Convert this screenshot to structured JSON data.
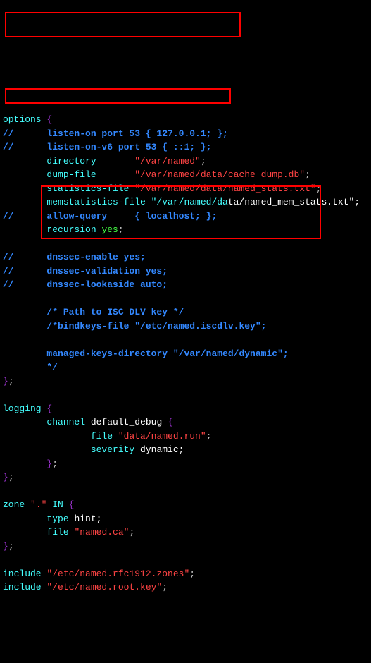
{
  "l0": {
    "a": "options",
    "b": "{"
  },
  "l1": {
    "a": "//      listen-on port 53 { 127.0.0.1; };"
  },
  "l2": {
    "a": "//      listen-on-v6 port 53 { ::1; };"
  },
  "l3": {
    "a": "        directory",
    "b": "\"/var/named\"",
    "c": ";"
  },
  "l4": {
    "a": "        dump-file",
    "b": "\"/var/named/data/cache_dump.db\"",
    "c": ";"
  },
  "l5": {
    "a": "        statistics-file",
    "b": "\"/var/named/data/named_stats.txt\"",
    "c": ";"
  },
  "l6": {
    "a": "        memstatistics-file \"/var/named/da",
    "b": "ta/named_mem_stats.txt\";"
  },
  "l7": {
    "a": "//      allow-query     { localhost; };"
  },
  "l8": {
    "a": "        recursion",
    "b": "yes",
    "c": ";"
  },
  "l9": {
    "a": "//      dnssec-enable yes;"
  },
  "l10": {
    "a": "//      dnssec-validation yes;"
  },
  "l11": {
    "a": "//      dnssec-lookaside auto;"
  },
  "l12": {
    "a": "        /* Path to ISC DLV key */"
  },
  "l13": {
    "a": "        /*bindkeys-file \"/etc/named.iscdlv.key\";"
  },
  "l14": {
    "a": "        managed-keys-directory \"/var/named/dynamic\";"
  },
  "l14b": {
    "a": "        */"
  },
  "l15": {
    "a": "}",
    "b": ";"
  },
  "l16": {
    "a": "logging",
    "b": "{"
  },
  "l17": {
    "a": "        channel",
    "b": "default_debug",
    "c": "{"
  },
  "l18": {
    "a": "                file",
    "b": "\"data/named.run\"",
    "c": ";"
  },
  "l19": {
    "a": "                severity",
    "b": "dynamic;"
  },
  "l20": {
    "a": "        }",
    "b": ";"
  },
  "l21": {
    "a": "}",
    "b": ";"
  },
  "l22": {
    "a": "zone",
    "b": "\".\"",
    "c": "IN",
    "d": "{"
  },
  "l23": {
    "a": "        type",
    "b": "hint;"
  },
  "l24": {
    "a": "        file",
    "b": "\"named.ca\"",
    "c": ";"
  },
  "l25": {
    "a": "}",
    "b": ";"
  },
  "l26": {
    "a": "include",
    "b": "\"/etc/named.rfc1912.zones\"",
    "c": ";"
  },
  "l27": {
    "a": "include",
    "b": "\"/etc/named.root.key\"",
    "c": ";"
  }
}
